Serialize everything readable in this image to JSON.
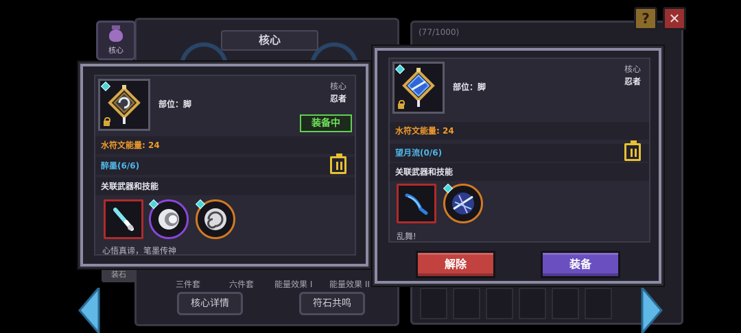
{
  "background": {
    "core_tab_label": "核心",
    "header_title": "核心",
    "progress": "(77/1000)",
    "left_cut_tab": "装石",
    "set_labels": [
      "三件套",
      "六件套",
      "能量效果 I",
      "能量效果 II"
    ],
    "buttons": {
      "core_details": "核心详情",
      "rune_resonance": "符石共鸣"
    }
  },
  "top_buttons": {
    "help": "?",
    "close": "✕"
  },
  "equipped_card": {
    "category": "核心",
    "class": "忍者",
    "slot": "部位：脚",
    "status_badge": "装备中",
    "energy": "水符文能量: 24",
    "set_name": "醉墨(6/6)",
    "related_title": "关联武器和技能",
    "caption": "心悟真谛，笔墨传神",
    "icon": "core-rune-swirl-icon",
    "skills": [
      "brush-weapon-icon",
      "ink-orb-icon",
      "ink-swirl-icon"
    ]
  },
  "compare_card": {
    "category": "核心",
    "class": "忍者",
    "slot": "部位：脚",
    "energy": "水符文能量: 24",
    "set_name": "望月流(0/6)",
    "related_title": "关联武器和技能",
    "caption": "乱舞!",
    "icon": "core-rune-crystal-icon",
    "skills": [
      "blade-weapon-icon",
      "lightning-slash-icon"
    ],
    "remove_label": "解除",
    "equip_label": "装备"
  },
  "colors": {
    "energy": "#f19a2a",
    "set": "#4fb6e8",
    "equipped": "#6de25a",
    "remove_button": "#c2423f",
    "equip_button": "#6a4fc0"
  }
}
